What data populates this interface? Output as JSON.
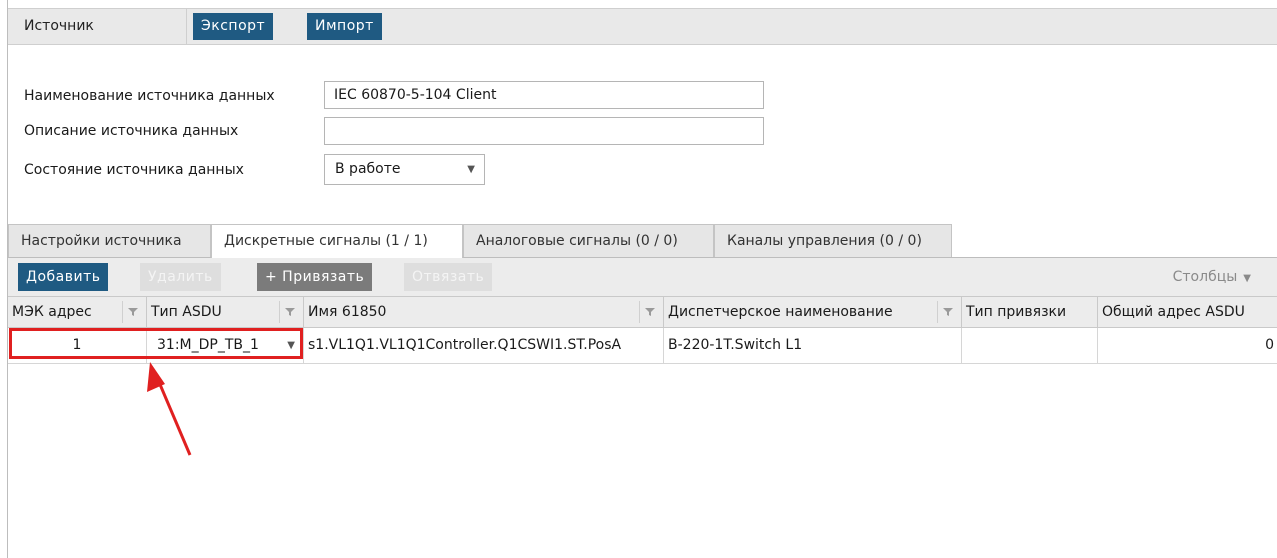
{
  "header": {
    "source_tab": "Источник",
    "export_button": "Экспорт",
    "import_button": "Импорт"
  },
  "form": {
    "name_label": "Наименование источника данных",
    "name_value": "IEC 60870-5-104 Client",
    "description_label": "Описание источника данных",
    "description_value": "",
    "state_label": "Состояние источника данных",
    "state_value": "В работе"
  },
  "tabs": [
    {
      "label": "Настройки источника",
      "active": false
    },
    {
      "label": "Дискретные сигналы (1 / 1)",
      "active": true
    },
    {
      "label": "Аналоговые сигналы (0 / 0)",
      "active": false
    },
    {
      "label": "Каналы управления (0 / 0)",
      "active": false
    }
  ],
  "toolbar": {
    "add": "Добавить",
    "delete": "Удалить",
    "bind": "+ Привязать",
    "unbind": "Отвязать",
    "columns": "Столбцы"
  },
  "grid": {
    "columns": [
      "МЭК адрес",
      "Тип ASDU",
      "Имя 61850",
      "Диспетчерское наименование",
      "Тип привязки",
      "Общий адрес ASDU"
    ],
    "rows": [
      {
        "iec_address": "1",
        "asdu_type": "31:M_DP_TB_1",
        "name_61850": "s1.VL1Q1.VL1Q1Controller.Q1CSWI1.ST.PosA",
        "dispatch_name": "В-220-1T.Switch L1",
        "binding_type": "",
        "common_address": "0"
      }
    ]
  },
  "colors": {
    "accent": "#1f5a82",
    "highlight": "#e02020"
  }
}
